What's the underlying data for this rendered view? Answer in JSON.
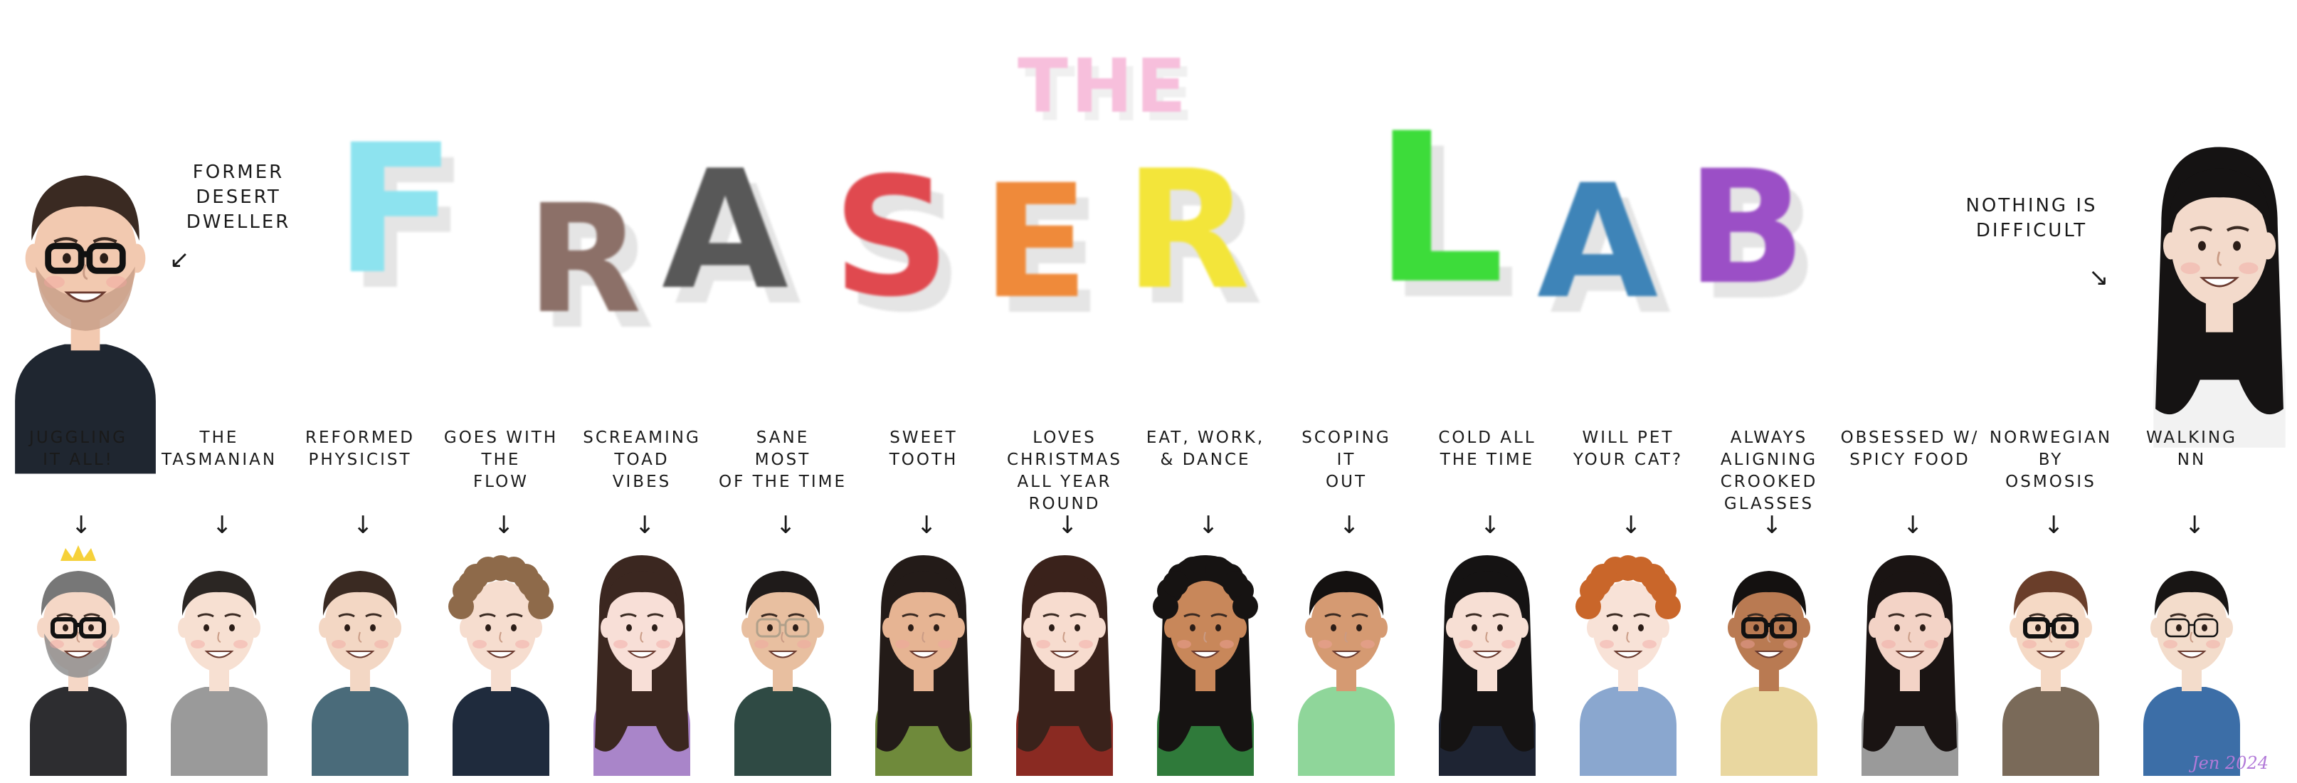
{
  "title": {
    "small": "THE",
    "word1": "FRASER",
    "word2": "LAB",
    "colors": {
      "F": "#8de3ef",
      "R": "#8c7068",
      "A1": "#585858",
      "S": "#e0494f",
      "E": "#ef8a3a",
      "R2": "#f3e53a",
      "L": "#3ddc3a",
      "A2": "#3e84b8",
      "B": "#9b4fc6",
      "the": "#f7bfdc"
    }
  },
  "side_people": {
    "left_note": "FORMER\nDESERT\nDWELLER",
    "right_note": "NOTHING IS\nDIFFICULT"
  },
  "members": [
    {
      "note": "JUGGLING\nIT ALL!",
      "hair": "#777",
      "skin": "#f5d7c6",
      "shirt": "#2d2d30",
      "beard": "#8f8f8f",
      "glasses": "thick",
      "crown": "#f6d13a"
    },
    {
      "note": "THE\nTASMANIAN",
      "hair": "#2b2623",
      "skin": "#f7e0d2",
      "shirt": "#9a9a9a",
      "glasses": "none"
    },
    {
      "note": "REFORMED\nPHYSICIST",
      "hair": "#3a2a22",
      "skin": "#f3d7c4",
      "shirt": "#4a6b7a",
      "glasses": "none"
    },
    {
      "note": "GOES WITH\nTHE\nFLOW",
      "hair": "#8e6a4a",
      "skin": "#f6ddcf",
      "shirt": "#1f2b3d",
      "glasses": "none",
      "curly": true
    },
    {
      "note": "SCREAMING\nTOAD\nVIBES",
      "hair": "#3b2720",
      "skin": "#f8dfd7",
      "shirt": "#a985c9",
      "glasses": "none",
      "long": true
    },
    {
      "note": "SANE\nMOST\nOF THE TIME",
      "hair": "#1f1b1a",
      "skin": "#e8bfa0",
      "shirt": "#2f4a44",
      "glasses": "light"
    },
    {
      "note": "SWEET\nTOOTH",
      "hair": "#231b18",
      "skin": "#e6b493",
      "shirt": "#6f8a3b",
      "glasses": "none",
      "long": true
    },
    {
      "note": "LOVES\nCHRISTMAS\nALL YEAR ROUND",
      "hair": "#3a221b",
      "skin": "#f7dccf",
      "shirt": "#8a2a22",
      "glasses": "none",
      "long": true
    },
    {
      "note": "EAT, WORK,\n& DANCE",
      "hair": "#161312",
      "skin": "#c8875a",
      "shirt": "#2f7a3a",
      "glasses": "none",
      "long": true,
      "curly": true
    },
    {
      "note": "SCOPING\nIT\nOUT",
      "hair": "#141110",
      "skin": "#d59a72",
      "shirt": "#8fd69a",
      "glasses": "none"
    },
    {
      "note": "COLD ALL\nTHE TIME",
      "hair": "#151313",
      "skin": "#f7dfd4",
      "shirt": "#1e2433",
      "glasses": "none",
      "long": true
    },
    {
      "note": "WILL PET\nYOUR CAT?",
      "hair": "#c9662a",
      "skin": "#f8e2d7",
      "shirt": "#8aa7cf",
      "glasses": "none",
      "curly": true
    },
    {
      "note": "ALWAYS\nALIGNING\nCROOKED\nGLASSES",
      "hair": "#141110",
      "skin": "#b97a52",
      "shirt": "#e9d7a0",
      "glasses": "thick"
    },
    {
      "note": "OBSESSED W/\nSPICY FOOD",
      "hair": "#1a1413",
      "skin": "#f3d3c6",
      "shirt": "#9a9a9a",
      "glasses": "none",
      "long": true
    },
    {
      "note": "NORWEGIAN\nBY\nOSMOSIS",
      "hair": "#6a3e2a",
      "skin": "#f5d9c5",
      "shirt": "#7a6a59",
      "glasses": "thick"
    },
    {
      "note": "WALKING\nNN",
      "hair": "#181514",
      "skin": "#f3dccb",
      "shirt": "#3c6ea7",
      "glasses": "thin"
    }
  ],
  "signature": "Jen 2024"
}
